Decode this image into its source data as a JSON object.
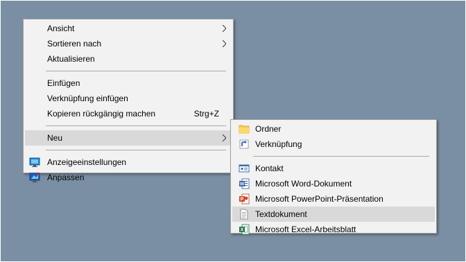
{
  "context_menu": {
    "items": [
      {
        "label": "Ansicht"
      },
      {
        "label": "Sortieren nach"
      },
      {
        "label": "Aktualisieren"
      },
      {
        "label": "Einfügen"
      },
      {
        "label": "Verknüpfung einfügen"
      },
      {
        "label": "Kopieren rückgängig machen",
        "shortcut": "Strg+Z"
      },
      {
        "label": "Neu"
      },
      {
        "label": "Anzeigeeinstellungen",
        "icon": "display-settings-icon"
      },
      {
        "label": "Anpassen",
        "icon": "personalize-icon"
      }
    ]
  },
  "new_submenu": {
    "items": [
      {
        "label": "Ordner",
        "icon": "folder-icon"
      },
      {
        "label": "Verknüpfung",
        "icon": "shortcut-icon"
      },
      {
        "label": "Kontakt",
        "icon": "contact-card-icon"
      },
      {
        "label": "Microsoft Word-Dokument",
        "icon": "word-document-icon"
      },
      {
        "label": "Microsoft PowerPoint-Präsentation",
        "icon": "powerpoint-icon"
      },
      {
        "label": "Textdokument",
        "icon": "text-document-icon"
      },
      {
        "label": "Microsoft Excel-Arbeitsblatt",
        "icon": "excel-icon"
      }
    ]
  },
  "colors": {
    "desktop": "#7a8fa3",
    "menu_background": "#f2f2f2",
    "highlight": "#d9d9d9",
    "separator": "#a8a8a8"
  }
}
